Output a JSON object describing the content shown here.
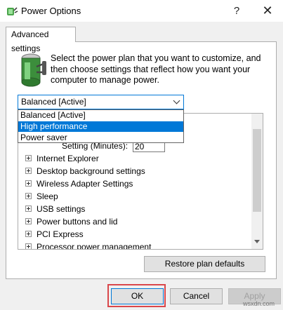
{
  "window": {
    "title": "Power Options",
    "help_glyph": "?",
    "close_glyph": "✕"
  },
  "tab": {
    "label": "Advanced settings"
  },
  "description": "Select the power plan that you want to customize, and then choose settings that reflect how you want your computer to manage power.",
  "plan_select": {
    "selected": "Balanced [Active]",
    "options": [
      "Balanced [Active]",
      "High performance",
      "Power saver"
    ],
    "highlighted_index": 1
  },
  "tree": {
    "partial_setting_label": "Setting (Minutes):",
    "partial_setting_value": "20",
    "items": [
      "Internet Explorer",
      "Desktop background settings",
      "Wireless Adapter Settings",
      "Sleep",
      "USB settings",
      "Power buttons and lid",
      "PCI Express",
      "Processor power management"
    ]
  },
  "buttons": {
    "restore": "Restore plan defaults",
    "ok": "OK",
    "cancel": "Cancel",
    "apply": "Apply"
  },
  "colors": {
    "accent": "#0078d7",
    "highlight_box": "#d9474b"
  },
  "watermark": "wsxdn.com"
}
